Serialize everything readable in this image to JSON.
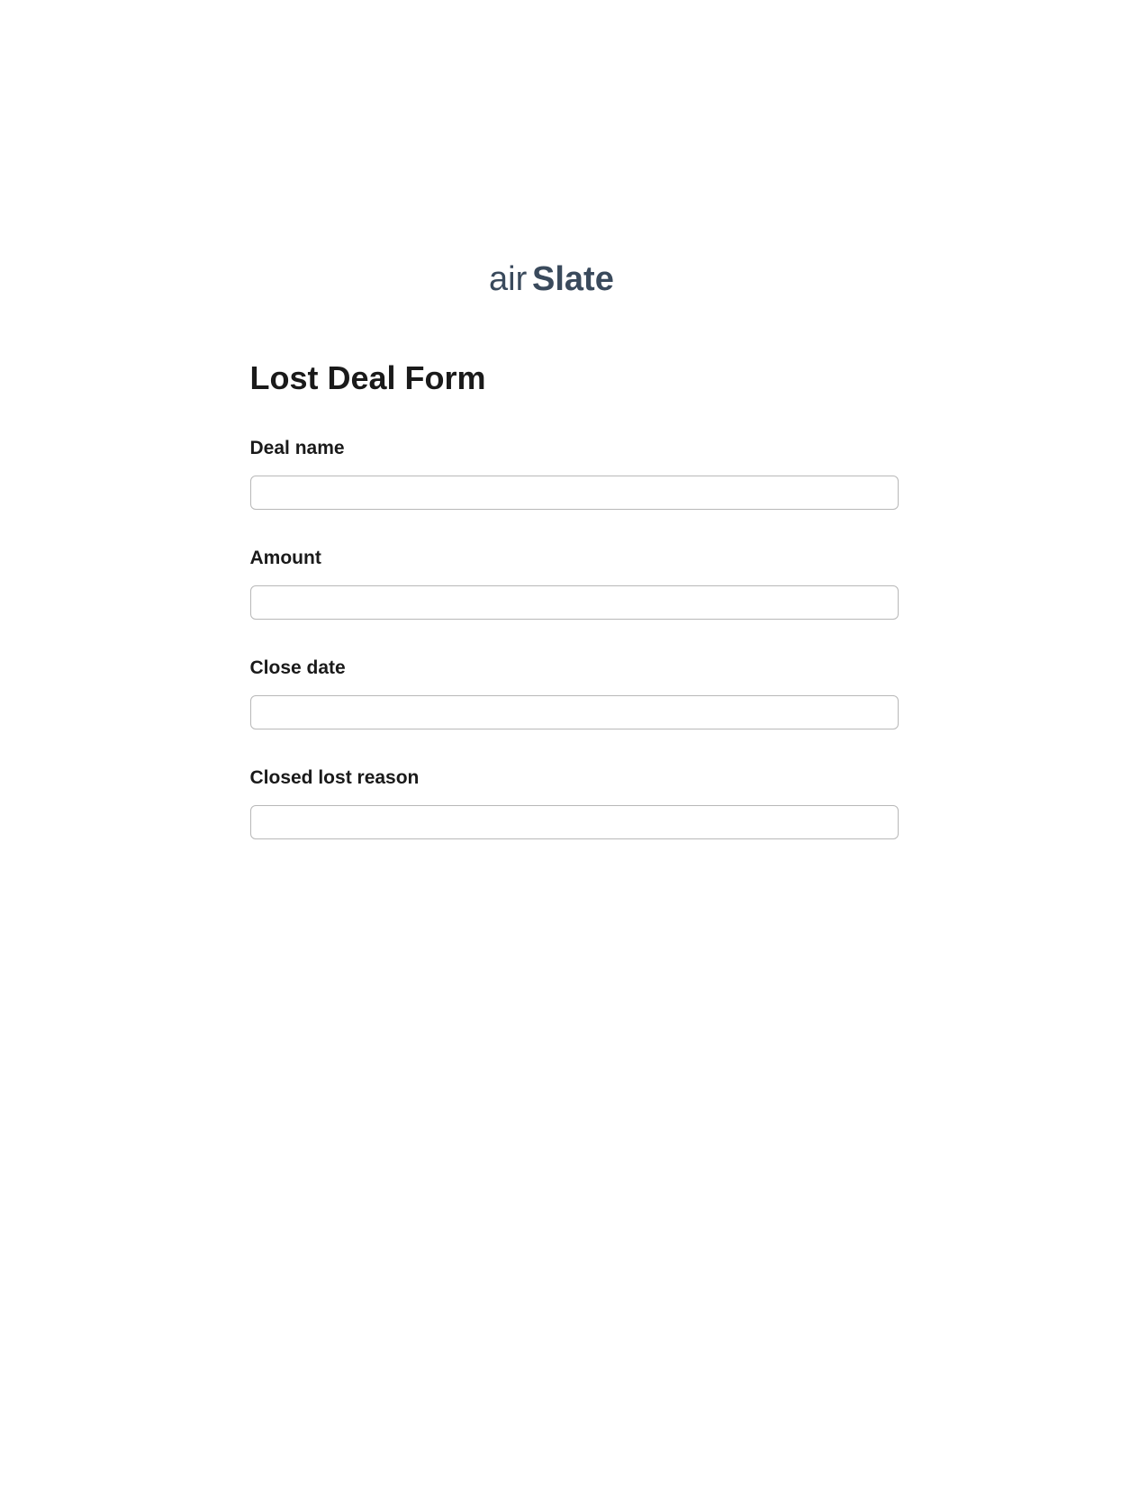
{
  "logo": {
    "text": "airSlate",
    "color": "#3a4a5c"
  },
  "form": {
    "title": "Lost Deal Form",
    "fields": [
      {
        "label": "Deal name",
        "value": ""
      },
      {
        "label": "Amount",
        "value": ""
      },
      {
        "label": "Close date",
        "value": ""
      },
      {
        "label": "Closed lost reason",
        "value": ""
      }
    ]
  }
}
